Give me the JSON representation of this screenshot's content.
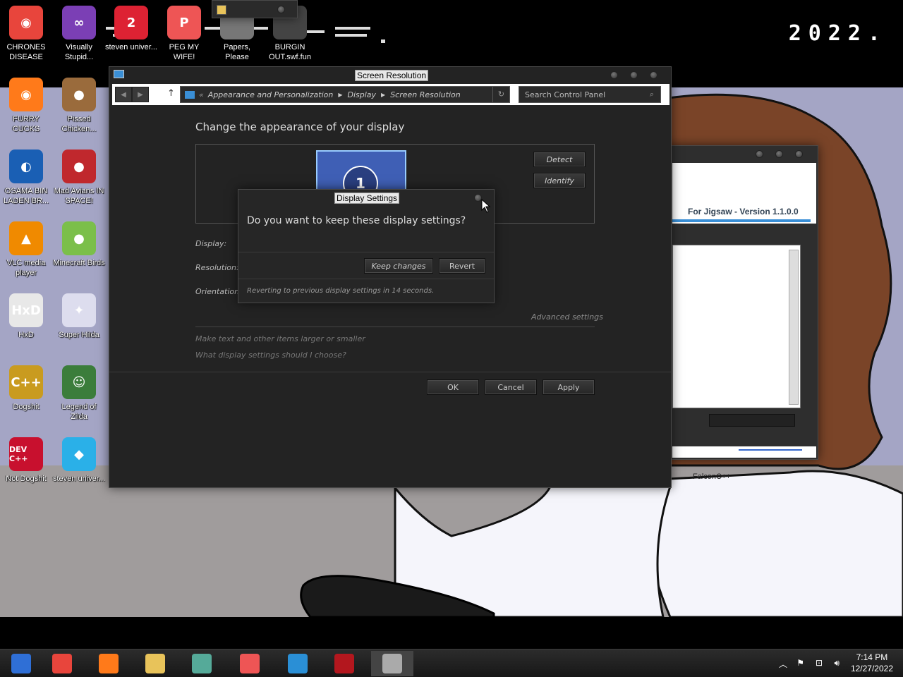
{
  "desktop": {
    "year": "2022.",
    "icons": [
      {
        "label": "CHRONES DISEASE",
        "color": "#e8453c",
        "glyph": "◉"
      },
      {
        "label": "Visually Stupid...",
        "color": "#7b3fb5",
        "glyph": "∞"
      },
      {
        "label": "steven univer...",
        "color": "#d23",
        "glyph": "2"
      },
      {
        "label": "PEG MY WIFE!",
        "color": "#e55",
        "glyph": "P"
      },
      {
        "label": "Papers, Please",
        "color": "#777",
        "glyph": ""
      },
      {
        "label": "BURGIN OUT.swf.fun",
        "color": "#444",
        "glyph": ""
      },
      {
        "label": "FURRY CUCKS",
        "color": "#ff7a1a",
        "glyph": "◉"
      },
      {
        "label": "Pissed Chicken...",
        "color": "#9a6b3c",
        "glyph": "●"
      },
      {
        "label": "OSAMA BIN LADEN BR...",
        "color": "#1a5fb4",
        "glyph": "◐"
      },
      {
        "label": "Mad Avians IN SPACE!",
        "color": "#c0282d",
        "glyph": "●"
      },
      {
        "label": "VLC media player",
        "color": "#f08a00",
        "glyph": "▲"
      },
      {
        "label": "Minecraft Birds",
        "color": "#7bbf4a",
        "glyph": "●"
      },
      {
        "label": "HxD",
        "color": "#e8e8e8",
        "glyph": "HxD"
      },
      {
        "label": "Super Hilda",
        "color": "#dde",
        "glyph": "✦"
      },
      {
        "label": "Dogshit",
        "color": "#c99b1f",
        "glyph": "C++"
      },
      {
        "label": "Legend of Zilda",
        "color": "#3b7d3b",
        "glyph": "☺"
      },
      {
        "label": "Not Dogshit",
        "color": "#c8102e",
        "glyph": "DEV C++"
      },
      {
        "label": "steven univer...",
        "color": "#2ab0e8",
        "glyph": "◆"
      }
    ],
    "behind_label": "FalconC++"
  },
  "mini_window": {
    "title": ""
  },
  "jigsaw_window": {
    "version_text": "For Jigsaw - Version 1.1.0.0"
  },
  "screen_resolution": {
    "title": "Screen Resolution",
    "breadcrumb": [
      "Appearance and Personalization",
      "Display",
      "Screen Resolution"
    ],
    "breadcrumb_prefix": "«",
    "search_placeholder": "Search Control Panel",
    "heading": "Change the appearance of your display",
    "monitor_number": "1",
    "detect_label": "Detect",
    "identify_label": "Identify",
    "display_label": "Display:",
    "resolution_label": "Resolution:",
    "orientation_label": "Orientation:",
    "advanced_link": "Advanced settings",
    "link1": "Make text and other items larger or smaller",
    "link2": "What display settings should I choose?",
    "ok_label": "OK",
    "cancel_label": "Cancel",
    "apply_label": "Apply"
  },
  "dialog": {
    "title": "Display Settings",
    "question": "Do you want to keep these display settings?",
    "keep_label": "Keep changes",
    "revert_label": "Revert",
    "countdown": "Reverting to previous display settings in 14 seconds."
  },
  "taskbar": {
    "time": "7:14 PM",
    "date": "12/27/2022",
    "apps": [
      {
        "name": "windows-logo-icon",
        "color": "#2f6fd6"
      },
      {
        "name": "chrome-icon",
        "color": "#e8453c"
      },
      {
        "name": "firefox-icon",
        "color": "#ff7a1a"
      },
      {
        "name": "file-explorer-icon",
        "color": "#e8c35a"
      },
      {
        "name": "users-icon",
        "color": "#5a9"
      },
      {
        "name": "control-panel-icon",
        "color": "#e55"
      },
      {
        "name": "remote-desktop-icon",
        "color": "#2a8fd6"
      },
      {
        "name": "game-icon",
        "color": "#b3171e"
      },
      {
        "name": "display-settings-icon",
        "color": "#aaa"
      }
    ]
  }
}
